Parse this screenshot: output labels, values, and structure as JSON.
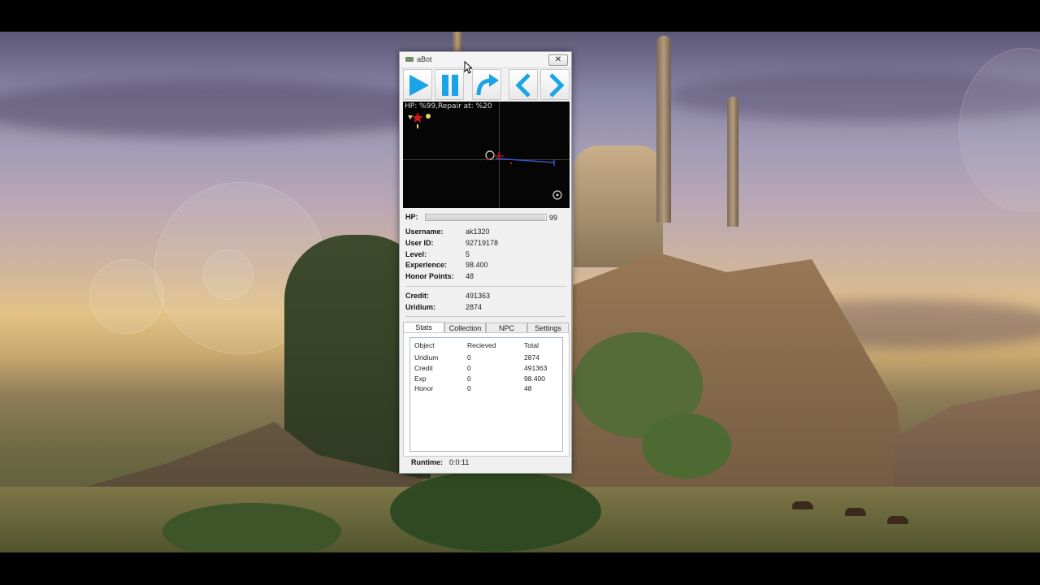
{
  "window": {
    "title": "aBot",
    "close_glyph": "✕",
    "icon": "app-icon"
  },
  "toolbar": {
    "buttons": [
      {
        "name": "play-button",
        "icon": "play-icon"
      },
      {
        "name": "pause-button",
        "icon": "pause-icon"
      },
      {
        "name": "redo-button",
        "icon": "redo-arrow-icon"
      },
      {
        "name": "previous-button",
        "icon": "chevron-left-icon"
      },
      {
        "name": "next-button",
        "icon": "chevron-right-icon"
      }
    ],
    "icon_color": "#1aa3e8"
  },
  "minimap": {
    "status": "HP: %99,Repair at: %20"
  },
  "hp": {
    "label": "HP:",
    "value": "99",
    "fraction": 0.99
  },
  "account": {
    "username_label": "Username:",
    "username": "ak1320",
    "userid_label": "User ID:",
    "userid": "92719178",
    "level_label": "Level:",
    "level": "5",
    "experience_label": "Experience:",
    "experience": "98.400",
    "honor_label": "Honor Points:",
    "honor": "48"
  },
  "currency": {
    "credit_label": "Credit:",
    "credit": "491363",
    "uridium_label": "Uridium:",
    "uridium": "2874"
  },
  "tabs": [
    "Stats",
    "Collection",
    "NPC",
    "Settings"
  ],
  "stats": {
    "columns": [
      "Object",
      "Recieved",
      "Total"
    ],
    "rows": [
      [
        "Uridium",
        "0",
        "2874"
      ],
      [
        "Credit",
        "0",
        "491363"
      ],
      [
        "Exp",
        "0",
        "98.400"
      ],
      [
        "Honor",
        "0",
        "48"
      ]
    ]
  },
  "runtime": {
    "label": "Runtime:",
    "value": "0:0:11"
  }
}
